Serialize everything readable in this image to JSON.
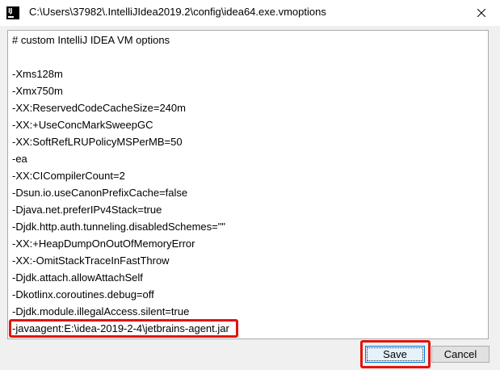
{
  "window": {
    "title": "C:\\Users\\37982\\.IntelliJIdea2019.2\\config\\idea64.exe.vmoptions",
    "app_icon": "intellij-idea-icon",
    "app_icon_text": "IJ",
    "close_icon": "close-icon"
  },
  "editor": {
    "lines": [
      "# custom IntelliJ IDEA VM options",
      "",
      "-Xms128m",
      "-Xmx750m",
      "-XX:ReservedCodeCacheSize=240m",
      "-XX:+UseConcMarkSweepGC",
      "-XX:SoftRefLRUPolicyMSPerMB=50",
      "-ea",
      "-XX:CICompilerCount=2",
      "-Dsun.io.useCanonPrefixCache=false",
      "-Djava.net.preferIPv4Stack=true",
      "-Djdk.http.auth.tunneling.disabledSchemes=\"\"",
      "-XX:+HeapDumpOnOutOfMemoryError",
      "-XX:-OmitStackTraceInFastThrow",
      "-Djdk.attach.allowAttachSelf",
      "-Dkotlinx.coroutines.debug=off",
      "-Djdk.module.illegalAccess.silent=true",
      "-javaagent:E:\\idea-2019-2-4\\jetbrains-agent.jar"
    ]
  },
  "buttons": {
    "save_label": "Save",
    "cancel_label": "Cancel"
  },
  "colors": {
    "annotation_red": "#e0150f",
    "focus_blue": "#0078d7"
  }
}
